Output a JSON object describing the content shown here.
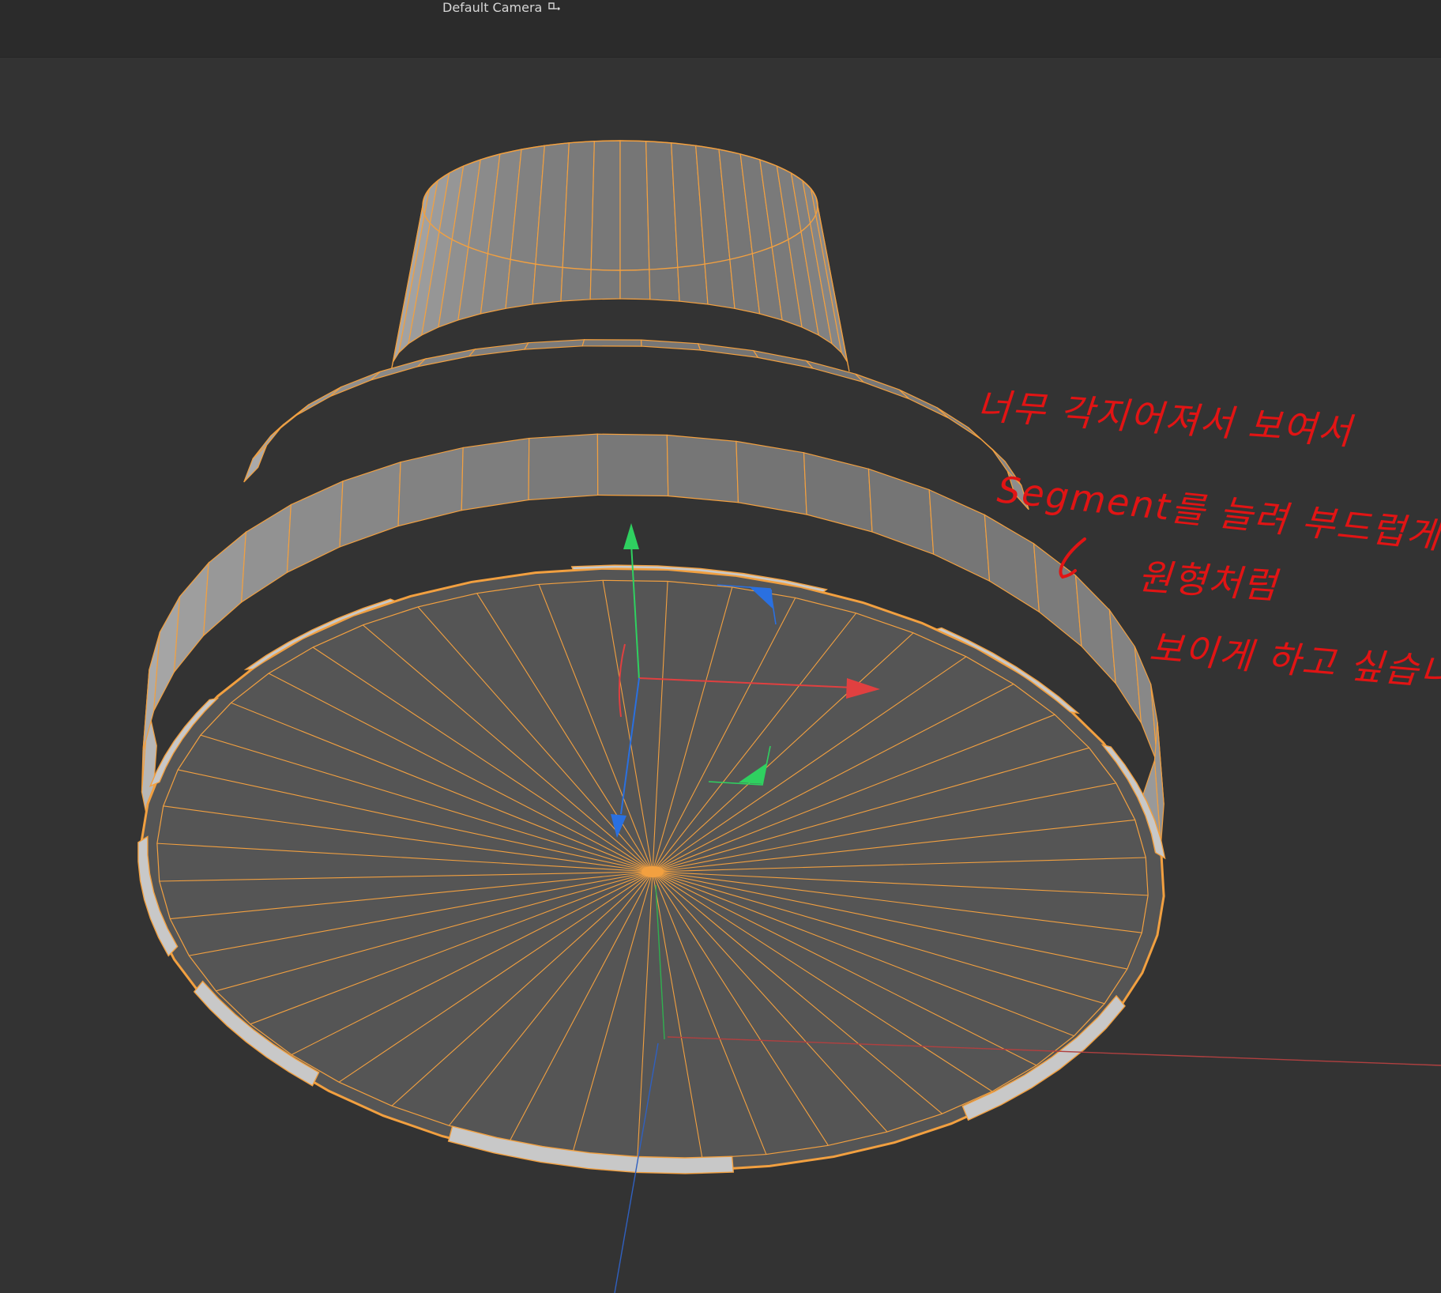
{
  "header": {
    "camera_label": "Default Camera",
    "camera_icon": "camera-link-icon"
  },
  "viewport": {
    "background": "#333333",
    "wire_color": "#f2a040",
    "shade_light": "#cfcfcf",
    "shade_dark": "#6a6a6a",
    "cap_color": "#555555",
    "axis_x_color": "#e04040",
    "axis_y_color": "#2fd060",
    "axis_z_color": "#2a70e0",
    "selected_object": "cylinder-mesh",
    "cap_segments": 48,
    "column_segments": 24
  },
  "annotation": {
    "color": "#e11414",
    "lines": [
      "너무 각지어져서 보여서",
      "Segment를 늘려 부드럽게",
      "원형처럼",
      "보이게 하고 싶습니다"
    ],
    "arrow_icon": "check-arrow-icon"
  }
}
